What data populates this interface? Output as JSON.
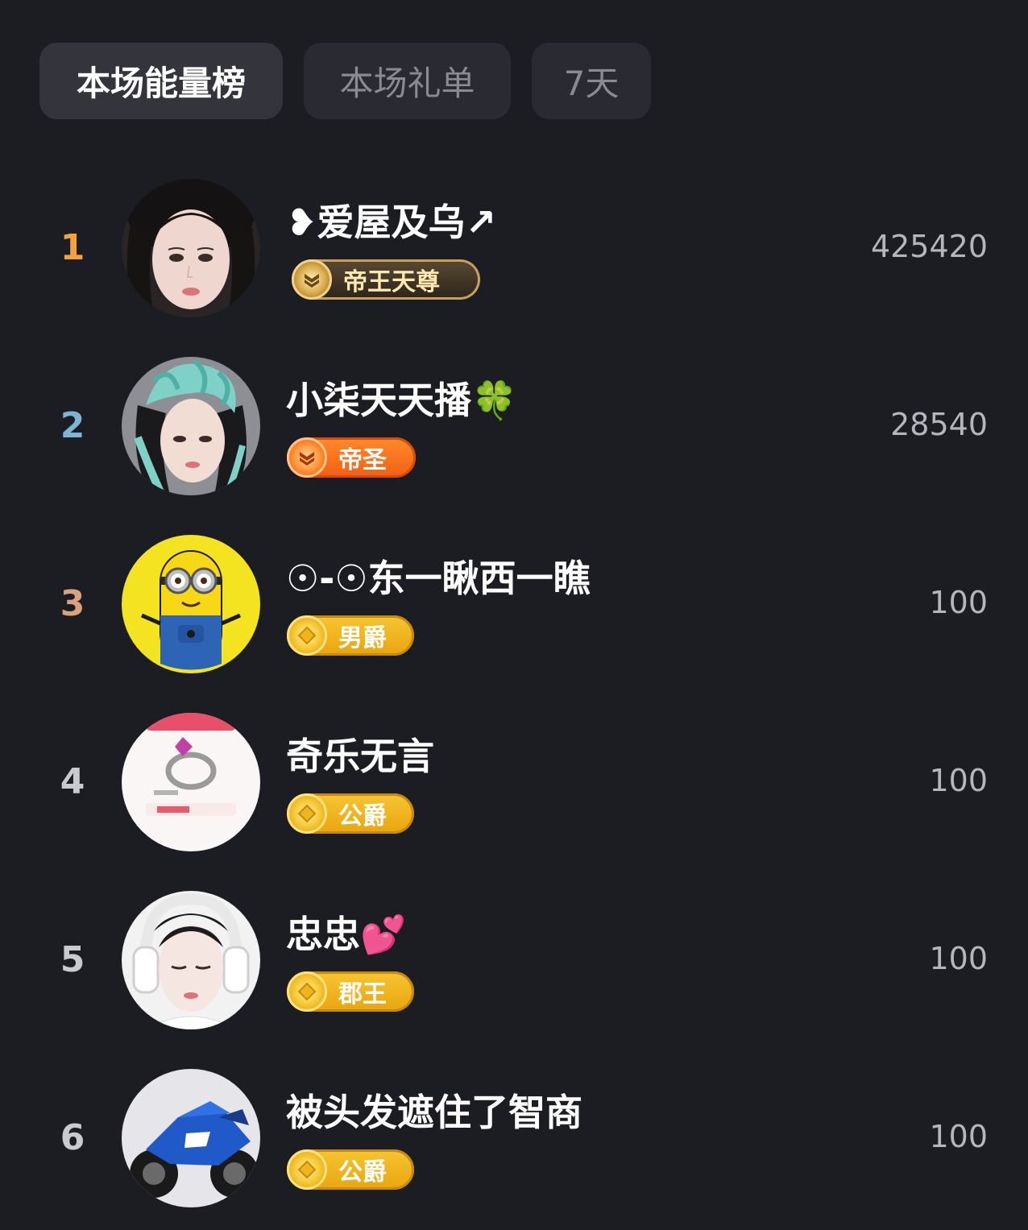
{
  "tabs": [
    {
      "label": "本场能量榜",
      "active": true
    },
    {
      "label": "本场礼单",
      "active": false
    },
    {
      "label": "7天",
      "active": false
    }
  ],
  "rank_colors": [
    "#f2a23a",
    "#7fb3d6",
    "#d9a27e",
    "#c9c9d0",
    "#c9c9d0",
    "#c9c9d0"
  ],
  "ranking": [
    {
      "rank": "1",
      "name": "❥爱屋及乌↗",
      "badge": "帝王天尊",
      "badge_style": "royal",
      "score": "425420",
      "avatar": "woman-portrait-avatar"
    },
    {
      "rank": "2",
      "name": "小柒天天播🍀",
      "badge": "帝圣",
      "badge_style": "orange",
      "score": "28540",
      "avatar": "woman-feather-headdress-avatar"
    },
    {
      "rank": "3",
      "name": "☉-☉东一瞅西一瞧",
      "badge": "男爵",
      "badge_style": "gold",
      "score": "100",
      "avatar": "minion-avatar"
    },
    {
      "rank": "4",
      "name": "奇乐无言",
      "badge": "公爵",
      "badge_style": "gold",
      "score": "100",
      "avatar": "ring-prize-avatar"
    },
    {
      "rank": "5",
      "name": "忠忠💕",
      "badge": "郡王",
      "badge_style": "gold",
      "score": "100",
      "avatar": "woman-headphones-avatar"
    },
    {
      "rank": "6",
      "name": "被头发遮住了智商",
      "badge": "公爵",
      "badge_style": "gold",
      "score": "100",
      "avatar": "motorcycle-avatar"
    }
  ]
}
